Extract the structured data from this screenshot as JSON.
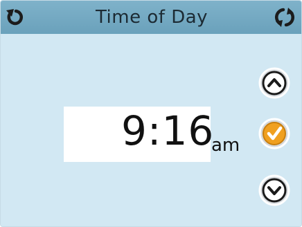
{
  "header": {
    "title": "Time of Day",
    "back_icon": "back-arrow-icon",
    "refresh_icon": "refresh-icon"
  },
  "time": {
    "value": "9:16",
    "period": "am"
  },
  "controls": {
    "up_icon": "chevron-up-icon",
    "confirm_icon": "checkmark-icon",
    "down_icon": "chevron-down-icon"
  },
  "colors": {
    "background": "#d2e8f3",
    "header": "#6aa1bb",
    "confirm": "#f0a020"
  }
}
